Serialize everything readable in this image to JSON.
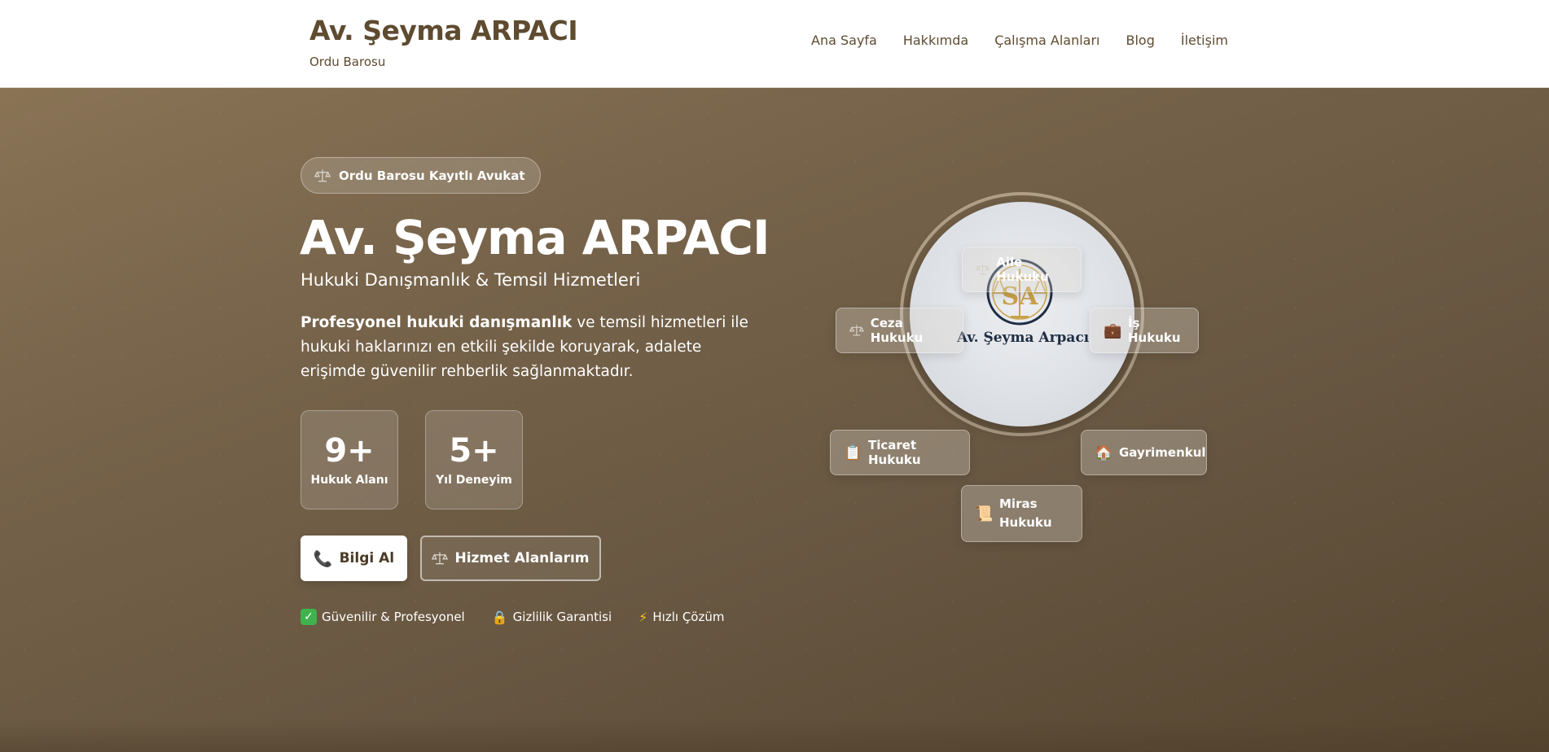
{
  "header": {
    "brand_title": "Av. Şeyma ARPACI",
    "brand_subtitle": "Ordu Barosu",
    "nav": [
      {
        "label": "Ana Sayfa"
      },
      {
        "label": "Hakkımda"
      },
      {
        "label": "Çalışma Alanları"
      },
      {
        "label": "Blog"
      },
      {
        "label": "İletişim"
      }
    ]
  },
  "hero": {
    "badge": "Ordu Barosu Kayıtlı Avukat",
    "title": "Av. Şeyma ARPACI",
    "subtitle": "Hukuki Danışmanlık & Temsil Hizmetleri",
    "description_bold": "Profesyonel hukuki danışmanlık",
    "description_rest": " ve temsil hizmetleri ile hukuki haklarınızı en etkili şekilde koruyarak, adalete erişimde güvenilir rehberlik sağlanmaktadır.",
    "stats": [
      {
        "value": "9+",
        "label": "Hukuk Alanı"
      },
      {
        "value": "5+",
        "label": "Yıl Deneyim"
      }
    ],
    "buttons": {
      "primary": "Bilgi Al",
      "secondary": "Hizmet Alanlarım"
    },
    "features": [
      {
        "label": "Güvenilir & Profesyonel"
      },
      {
        "label": "Gizlilik Garantisi"
      },
      {
        "label": "Hızlı Çözüm"
      }
    ]
  },
  "diagram": {
    "logo_text": "Av. Şeyma Arpacı",
    "logo_monogram": "SA",
    "areas": [
      {
        "label": "Aile Hukuku",
        "icon": "scale-icon"
      },
      {
        "label": "İş Hukuku",
        "icon": "briefcase-icon"
      },
      {
        "label": "Ceza Hukuku",
        "icon": "scale-icon"
      },
      {
        "label": "Ticaret Hukuku",
        "icon": "clipboard-icon"
      },
      {
        "label": "Gayrimenkul",
        "icon": "house-icon"
      },
      {
        "label": "Miras Hukuku",
        "icon": "scroll-icon"
      }
    ]
  },
  "colors": {
    "brand": "#5e4b30",
    "hero_bg": "#6b5a44",
    "accent_gold": "#c8a24a",
    "check_green": "#3fb24d"
  }
}
